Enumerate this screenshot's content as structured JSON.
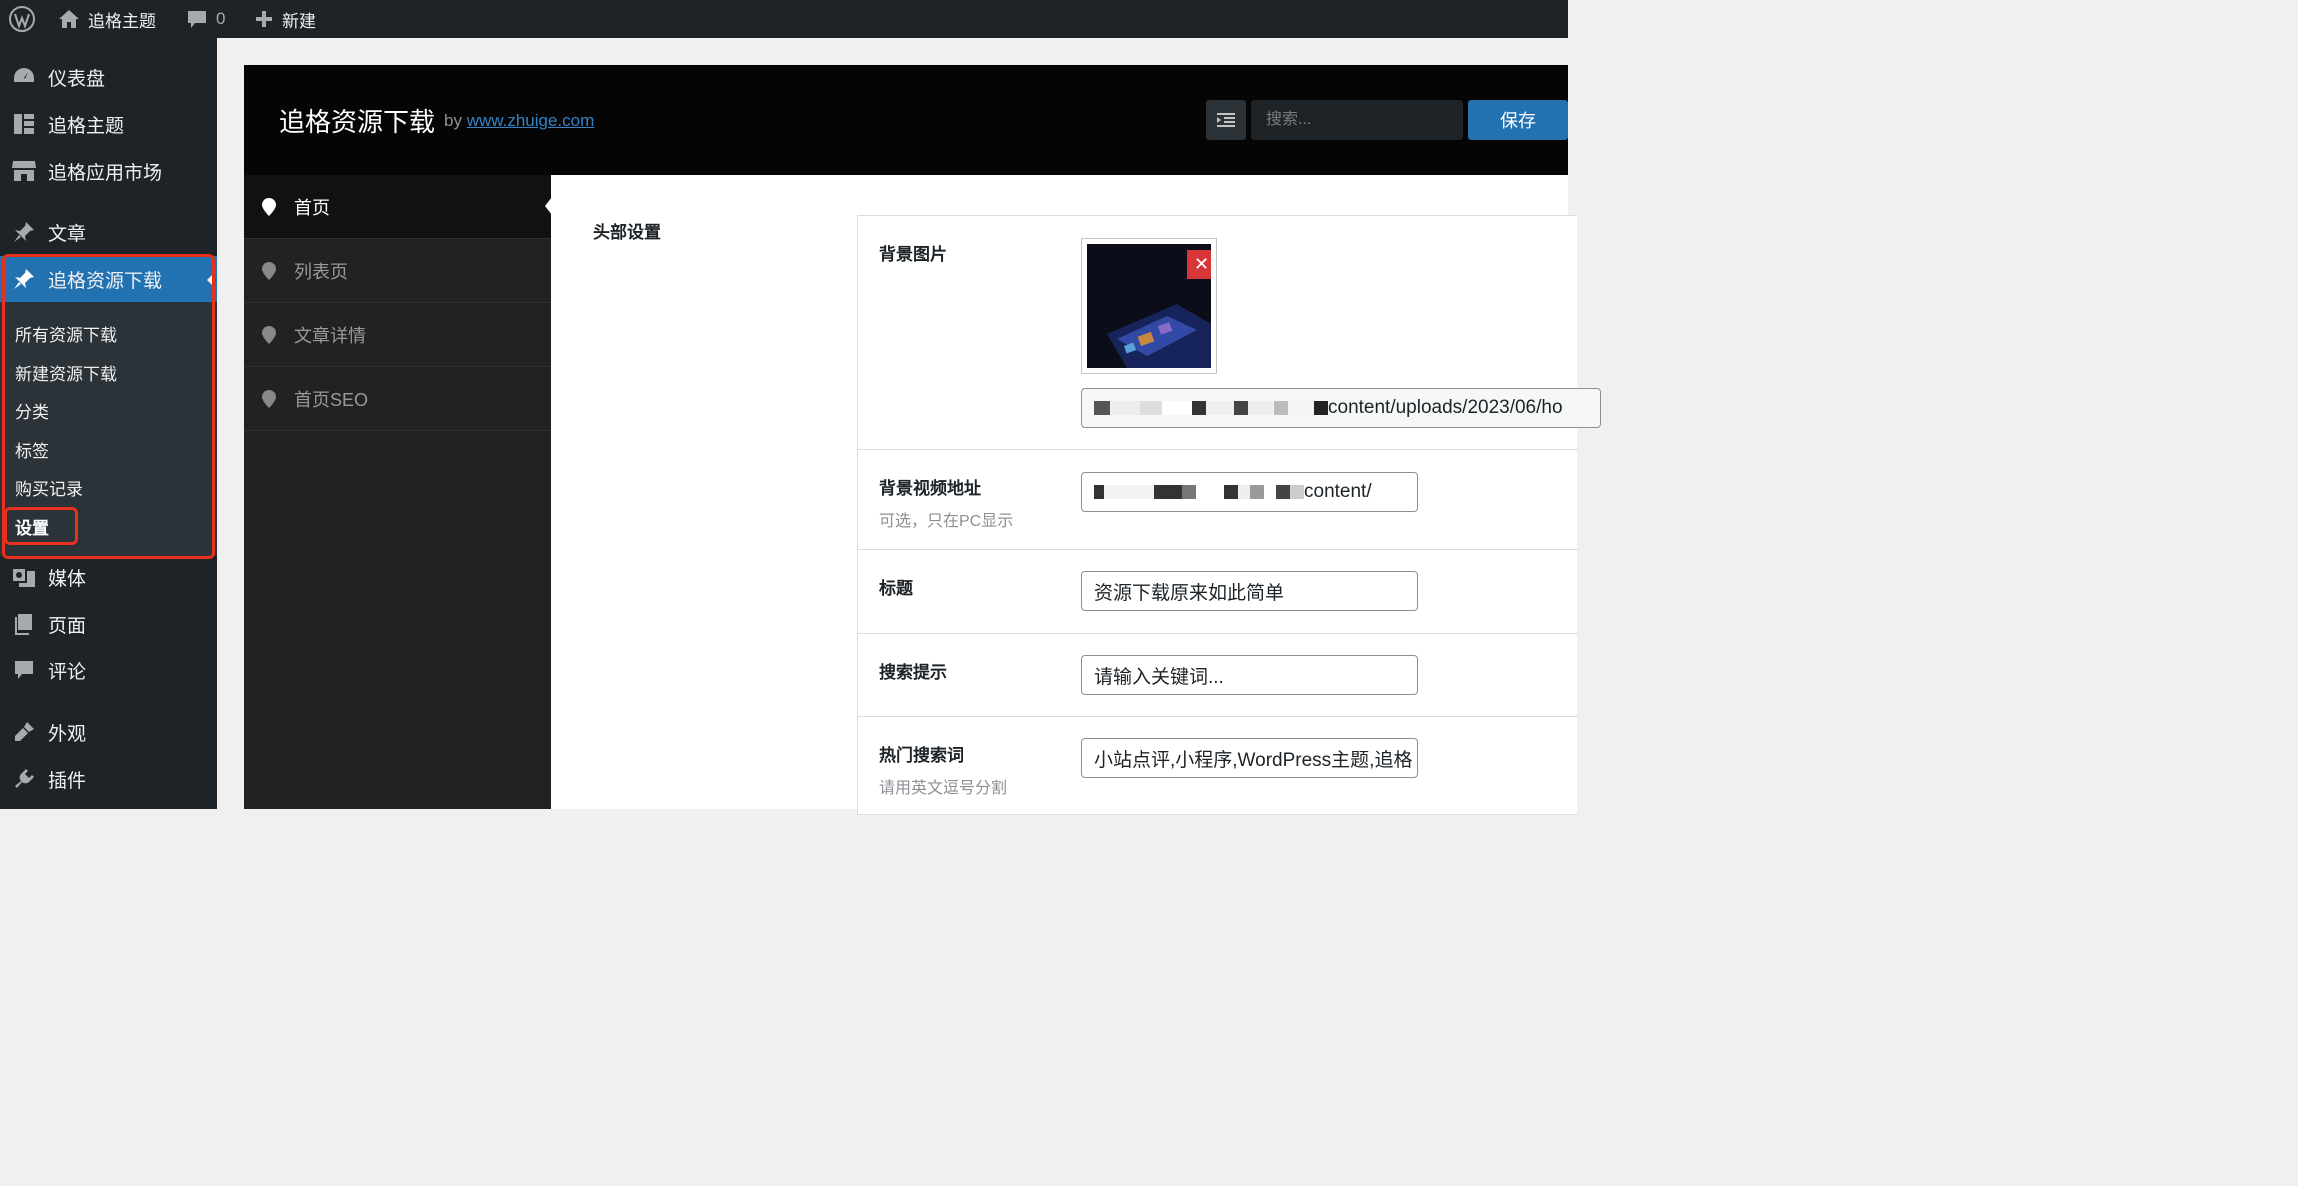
{
  "admin_bar": {
    "site_name": "追格主题",
    "comments_count": "0",
    "new_label": "新建"
  },
  "sidebar": {
    "items": [
      {
        "label": "仪表盘",
        "icon": "dashboard-icon"
      },
      {
        "label": "追格主题",
        "icon": "layout-icon"
      },
      {
        "label": "追格应用市场",
        "icon": "store-icon"
      },
      {
        "label": "文章",
        "icon": "pin-icon"
      },
      {
        "label": "追格资源下载",
        "icon": "pin-icon",
        "current": true
      },
      {
        "label": "媒体",
        "icon": "media-icon"
      },
      {
        "label": "页面",
        "icon": "page-icon"
      },
      {
        "label": "评论",
        "icon": "comment-icon"
      },
      {
        "label": "外观",
        "icon": "appearance-icon"
      },
      {
        "label": "插件",
        "icon": "plugin-icon"
      }
    ],
    "submenu": [
      "所有资源下载",
      "新建资源下载",
      "分类",
      "标签",
      "购买记录",
      "设置"
    ]
  },
  "panel": {
    "title": "追格资源下载",
    "by_label": "by",
    "by_link": "www.zhuige.com",
    "search_placeholder": "搜索...",
    "save_label": "保存",
    "nav": [
      "首页",
      "列表页",
      "文章详情",
      "首页SEO"
    ],
    "section_title": "头部设置",
    "fields": {
      "bg_image": {
        "label": "背景图片",
        "url_tail": "content/uploads/2023/06/ho"
      },
      "bg_video": {
        "label": "背景视频地址",
        "hint": "可选，只在PC显示",
        "url_tail": "content/"
      },
      "title": {
        "label": "标题",
        "value": "资源下载原来如此简单"
      },
      "search_tip": {
        "label": "搜索提示",
        "value": "请输入关键词..."
      },
      "hot_words": {
        "label": "热门搜索词",
        "hint": "请用英文逗号分割",
        "value": "小站点评,小程序,WordPress主题,追格"
      }
    }
  },
  "colors": {
    "accent": "#2271b1",
    "highlight": "#e8311d",
    "sidebar_bg": "#1d2327"
  }
}
